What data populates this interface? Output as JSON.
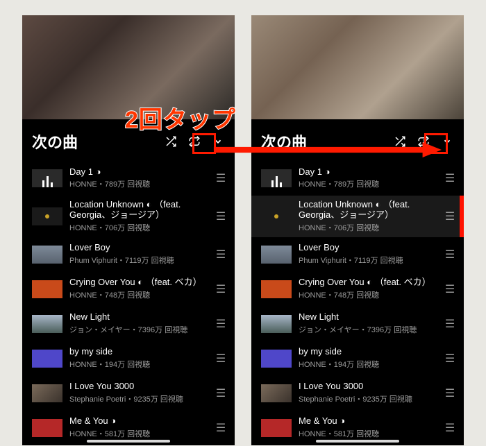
{
  "annotation": {
    "balloon": "2回タップ"
  },
  "section": {
    "title": "次の曲"
  },
  "songs": [
    {
      "title": "Day 1 ◑",
      "meta": "HONNE・789万 回視聴",
      "thumb": "eq"
    },
    {
      "title": "Location Unknown ◐ （feat. Georgia、ジョージア）",
      "meta": "HONNE・706万 回視聴",
      "thumb": "c2"
    },
    {
      "title": "Lover Boy",
      "meta": "Phum Viphurit・7119万 回視聴",
      "thumb": "c3"
    },
    {
      "title": "Crying Over You ◐ （feat. ベカ）",
      "meta": "HONNE・748万 回視聴",
      "thumb": "c4"
    },
    {
      "title": "New Light",
      "meta": "ジョン・メイヤー・7396万 回視聴",
      "thumb": "c5"
    },
    {
      "title": "by my side",
      "meta": "HONNE・194万 回視聴",
      "thumb": "c6"
    },
    {
      "title": "I Love You 3000",
      "meta": "Stephanie Poetri・9235万 回視聴",
      "thumb": "c7"
    },
    {
      "title": "Me & You ◑",
      "meta": "HONNE・581万 回視聴",
      "thumb": "c8"
    }
  ]
}
